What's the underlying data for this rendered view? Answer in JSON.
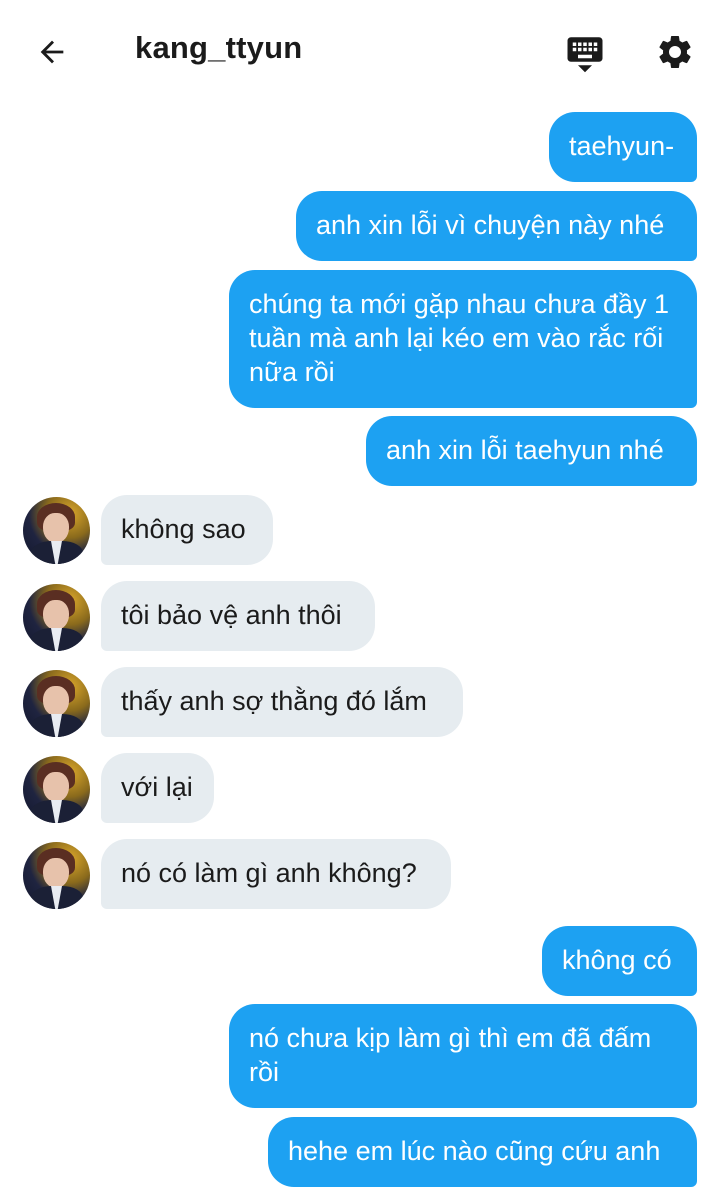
{
  "header": {
    "title": "kang_ttyun",
    "back_icon": "arrow-left-icon",
    "keyboard_icon": "keyboard-icon",
    "settings_icon": "gear-icon"
  },
  "colors": {
    "outgoing_bubble": "#1da1f2",
    "incoming_bubble": "#e6ecf0",
    "outgoing_text": "#ffffff",
    "incoming_text": "#1b1b1b"
  },
  "messages": [
    {
      "direction": "out",
      "text": "taehyun-"
    },
    {
      "direction": "out",
      "text": "anh xin lỗi vì chuyện này nhé"
    },
    {
      "direction": "out",
      "text": "chúng ta mới gặp nhau chưa đầy 1 tuần mà anh lại kéo em vào rắc rối nữa rồi"
    },
    {
      "direction": "out",
      "text": "anh xin lỗi taehyun nhé"
    },
    {
      "direction": "in",
      "text": "không sao"
    },
    {
      "direction": "in",
      "text": "tôi bảo vệ anh thôi"
    },
    {
      "direction": "in",
      "text": "thấy anh sợ thằng đó lắm"
    },
    {
      "direction": "in",
      "text": "với lại"
    },
    {
      "direction": "in",
      "text": "nó có làm gì anh không?"
    },
    {
      "direction": "out",
      "text": "không có"
    },
    {
      "direction": "out",
      "text": "nó chưa kịp làm gì thì em đã đấm rồi"
    },
    {
      "direction": "out",
      "text": "hehe em lúc nào cũng cứu anh"
    }
  ]
}
